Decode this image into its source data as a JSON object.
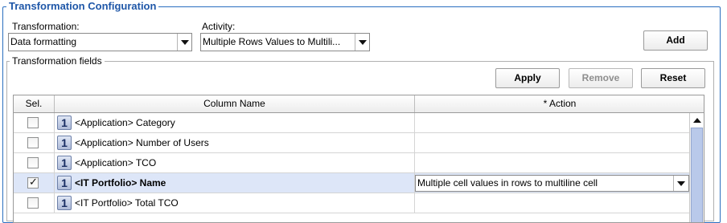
{
  "section_title": "Transformation Configuration",
  "transformation": {
    "label": "Transformation:",
    "value": "Data formatting"
  },
  "activity": {
    "label": "Activity:",
    "value": "Multiple Rows Values to Multili..."
  },
  "add_button": "Add",
  "fields_title": "Transformation fields",
  "buttons": {
    "apply": "Apply",
    "remove": "Remove",
    "reset": "Reset"
  },
  "table": {
    "headers": [
      "Sel.",
      "Column Name",
      "* Action"
    ],
    "rows": [
      {
        "selected": false,
        "icon": "1",
        "name": "<Application> Category",
        "action": ""
      },
      {
        "selected": false,
        "icon": "1",
        "name": "<Application> Number of Users",
        "action": ""
      },
      {
        "selected": false,
        "icon": "1",
        "name": "<Application> TCO",
        "action": ""
      },
      {
        "selected": true,
        "icon": "1",
        "name": "<IT Portfolio> Name",
        "action": "Multiple cell values in rows to multiline cell"
      },
      {
        "selected": false,
        "icon": "1",
        "name": "<IT Portfolio> Total TCO",
        "action": ""
      }
    ]
  },
  "colors": {
    "accent": "#1f57a8",
    "selected_row": "#dde6f8",
    "scroll_thumb": "#b9c9ea"
  }
}
